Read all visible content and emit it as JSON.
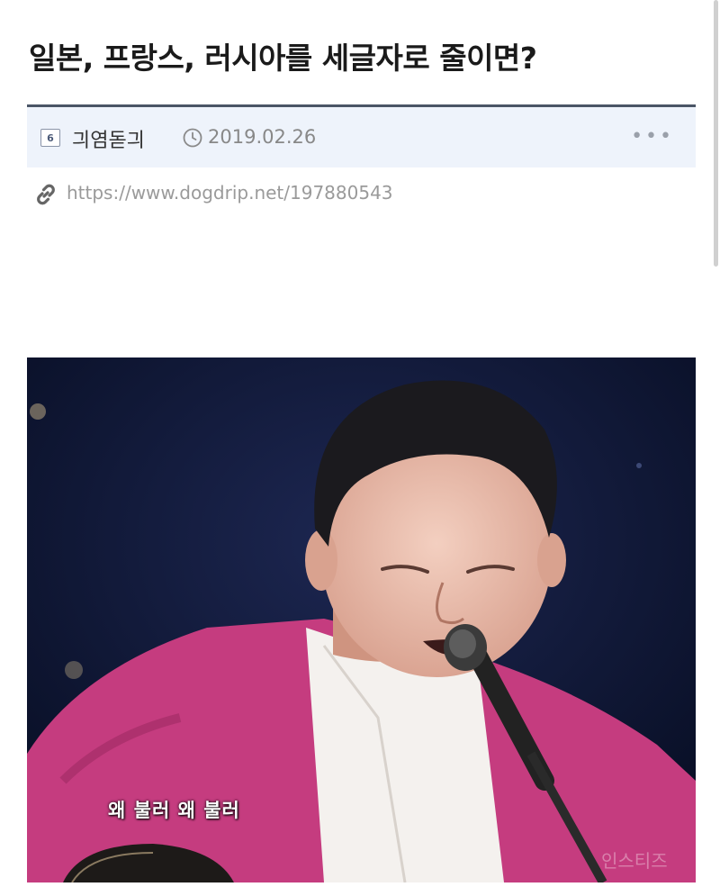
{
  "post": {
    "title": "일본, 프랑스, 러시아를 세글자로 줄이면?",
    "level_badge": "6",
    "author": "긔염돋긔",
    "date": "2019.02.26",
    "more_label": "•••",
    "url": "https://www.dogdrip.net/197880543"
  },
  "image": {
    "subtitle": "왜 불러 왜 불러",
    "watermark": "인스티즈"
  },
  "icons": {
    "clock": "clock-icon",
    "link": "link-icon",
    "more": "more-icon"
  },
  "colors": {
    "meta_background": "#eef3fb",
    "meta_border": "#4a5566",
    "jacket": "#c53c7f",
    "stage_background": "#0c1530"
  }
}
